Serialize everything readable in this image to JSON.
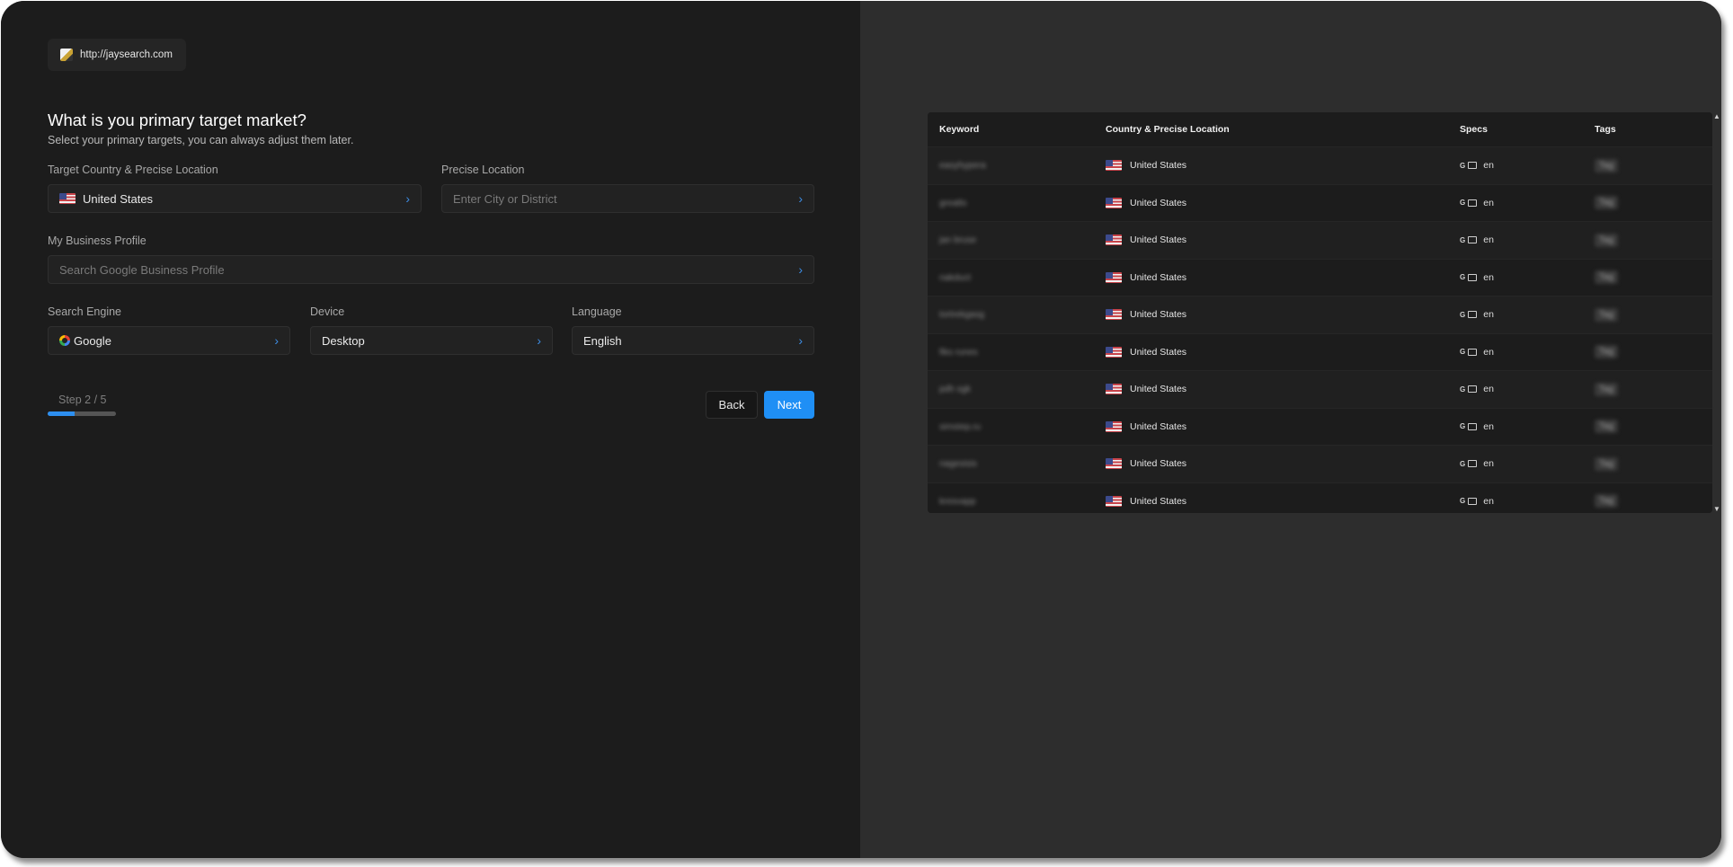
{
  "site": {
    "url": "http://jaysearch.com"
  },
  "heading": {
    "title": "What is you primary target market?",
    "subtitle": "Select your primary targets, you can always adjust them later."
  },
  "form": {
    "country": {
      "label": "Target Country & Precise Location",
      "value": "United States"
    },
    "precise": {
      "label": "Precise Location",
      "placeholder": "Enter City or District"
    },
    "business": {
      "label": "My Business Profile",
      "placeholder": "Search Google Business Profile"
    },
    "engine": {
      "label": "Search Engine",
      "value": "Google"
    },
    "device": {
      "label": "Device",
      "value": "Desktop"
    },
    "language": {
      "label": "Language",
      "value": "English"
    }
  },
  "steps": {
    "text": "Step 2 / 5",
    "current": 2,
    "total": 5,
    "progress": 0.4
  },
  "buttons": {
    "back": "Back",
    "next": "Next"
  },
  "table": {
    "headers": {
      "keyword": "Keyword",
      "location": "Country & Precise Location",
      "specs": "Specs",
      "tags": "Tags"
    },
    "rows": [
      {
        "keyword": "easyhypera",
        "location": "United States",
        "spec_lang": "en",
        "tag": "Tag"
      },
      {
        "keyword": "greatlo",
        "location": "United States",
        "spec_lang": "en",
        "tag": "Tag"
      },
      {
        "keyword": "jan bruse",
        "location": "United States",
        "spec_lang": "en",
        "tag": "Tag"
      },
      {
        "keyword": "nakduct",
        "location": "United States",
        "spec_lang": "en",
        "tag": "Tag"
      },
      {
        "keyword": "tortrekgasg",
        "location": "United States",
        "spec_lang": "en",
        "tag": "Tag"
      },
      {
        "keyword": "fiks runes",
        "location": "United States",
        "spec_lang": "en",
        "tag": "Tag"
      },
      {
        "keyword": "pdh sgk",
        "location": "United States",
        "spec_lang": "en",
        "tag": "Tag"
      },
      {
        "keyword": "simstep.ru",
        "location": "United States",
        "spec_lang": "en",
        "tag": "Tag"
      },
      {
        "keyword": "nagesisis",
        "location": "United States",
        "spec_lang": "en",
        "tag": "Tag"
      },
      {
        "keyword": "kresvapp",
        "location": "United States",
        "spec_lang": "en",
        "tag": "Tag"
      }
    ]
  },
  "colors": {
    "accent": "#1f8ff5",
    "left_bg": "#1c1c1c",
    "right_bg": "#2d2d2d"
  }
}
